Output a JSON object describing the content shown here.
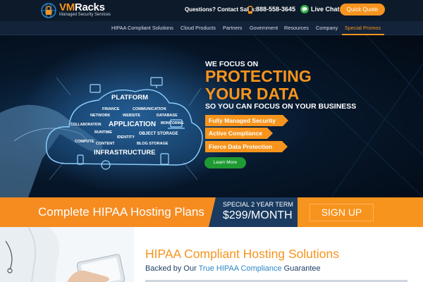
{
  "header": {
    "logo_vm": "VM",
    "logo_racks": "Racks",
    "logo_tagline": "Managed Security Services",
    "contact_label": "Questions? Contact Sales:",
    "phone": "888-558-3645",
    "chat_label": "Live Chat",
    "quote_button": "Quick Quote"
  },
  "nav": {
    "items": [
      {
        "label": "HIPAA Compliant Solutions"
      },
      {
        "label": "Cloud Products"
      },
      {
        "label": "Partners"
      },
      {
        "label": "Government"
      },
      {
        "label": "Resources"
      },
      {
        "label": "Company"
      },
      {
        "label": "Special Promos",
        "active": true
      }
    ]
  },
  "hero": {
    "line1": "WE FOCUS ON",
    "line2": "PROTECTING",
    "line3": "YOUR DATA",
    "line4": "SO YOU CAN FOCUS ON YOUR BUSINESS",
    "features": [
      "Fully Managed Security",
      "Active Compliance",
      "Fierce Data Protection"
    ],
    "learn_more": "Learn More",
    "cloud_words": [
      "PLATFORM",
      "FINANCE",
      "COMMUNICATION",
      "NETWORK",
      "WEBSITE",
      "DATABASE",
      "APPLICATION",
      "MONITORING",
      "COLLABORATION",
      "RUNTIME",
      "IDENTITY",
      "OBJECT STORAGE",
      "COMPUTE",
      "CONTENT",
      "BLOG STORAGE",
      "INFRASTRUCTURE"
    ]
  },
  "promo": {
    "headline": "Complete HIPAA Hosting Plans",
    "term": "SPECIAL 2 YEAR TERM",
    "price": "$299/MONTH",
    "signup": "SIGN UP"
  },
  "section": {
    "title": "HIPAA Compliant Hosting Solutions",
    "sub_before": "Backed by Our ",
    "sub_link": "True HIPAA Compliance",
    "sub_after": " Guarantee"
  },
  "colors": {
    "accent": "#f7941d",
    "dark": "#0d1a2a",
    "green": "#1f9a32",
    "link": "#2c86c8"
  }
}
